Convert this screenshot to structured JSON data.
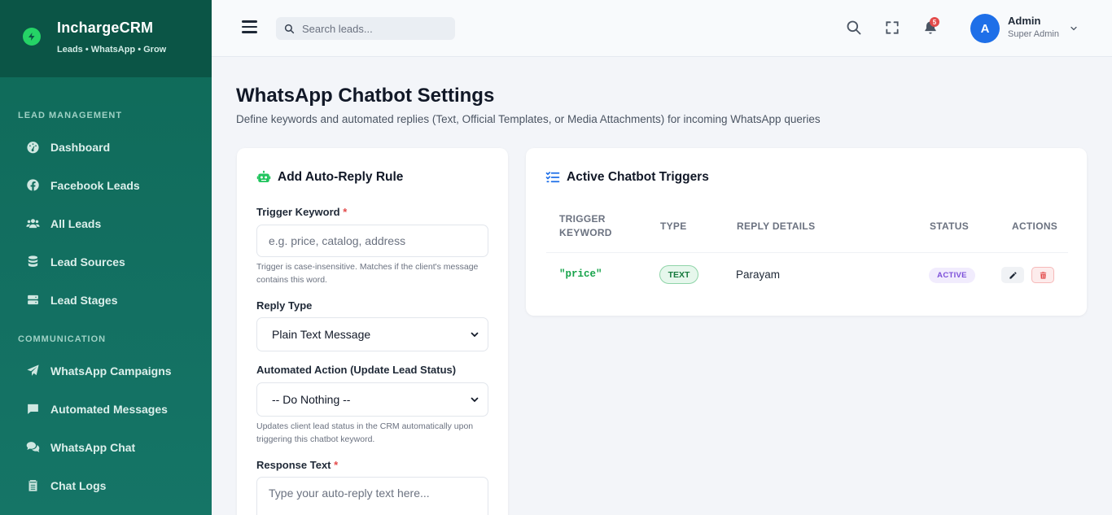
{
  "brand": {
    "name": "InchargeCRM",
    "tagline": "Leads • WhatsApp • Grow"
  },
  "sidebar": {
    "sections": [
      {
        "label": "LEAD MANAGEMENT",
        "items": [
          {
            "label": "Dashboard",
            "icon": "gauge-icon"
          },
          {
            "label": "Facebook Leads",
            "icon": "facebook-icon"
          },
          {
            "label": "All Leads",
            "icon": "users-icon"
          },
          {
            "label": "Lead Sources",
            "icon": "database-icon"
          },
          {
            "label": "Lead Stages",
            "icon": "server-icon"
          }
        ]
      },
      {
        "label": "COMMUNICATION",
        "items": [
          {
            "label": "WhatsApp Campaigns",
            "icon": "paper-plane-icon"
          },
          {
            "label": "Automated Messages",
            "icon": "message-square-icon"
          },
          {
            "label": "WhatsApp Chat",
            "icon": "comments-icon"
          },
          {
            "label": "Chat Logs",
            "icon": "clipboard-list-icon"
          }
        ]
      }
    ]
  },
  "header": {
    "search_placeholder": "Search leads...",
    "notification_count": "5",
    "user": {
      "initial": "A",
      "name": "Admin",
      "role": "Super Admin"
    }
  },
  "page": {
    "title": "WhatsApp Chatbot Settings",
    "subtitle": "Define keywords and automated replies (Text, Official Templates, or Media Attachments) for incoming WhatsApp queries"
  },
  "form": {
    "title": "Add Auto-Reply Rule",
    "trigger_label": "Trigger Keyword",
    "required_mark": "*",
    "trigger_placeholder": "e.g. price, catalog, address",
    "trigger_hint": "Trigger is case-insensitive. Matches if the client's message contains this word.",
    "reply_type_label": "Reply Type",
    "reply_type_value": "Plain Text Message",
    "action_label": "Automated Action (Update Lead Status)",
    "action_value": "-- Do Nothing --",
    "action_hint": "Updates client lead status in the CRM automatically upon triggering this chatbot keyword.",
    "response_label": "Response Text",
    "response_placeholder": "Type your auto-reply text here..."
  },
  "triggers": {
    "title": "Active Chatbot Triggers",
    "columns": [
      "TRIGGER KEYWORD",
      "TYPE",
      "REPLY DETAILS",
      "STATUS",
      "ACTIONS"
    ],
    "rows": [
      {
        "keyword": "\"price\"",
        "type": "TEXT",
        "reply": "Parayam",
        "status": "ACTIVE"
      }
    ]
  },
  "colors": {
    "sidebar": "#0f6a58",
    "accent_blue": "#1e6fe8",
    "whatsapp_green": "#25d366",
    "danger": "#e34b4b",
    "status_purple": "#7c4fd9"
  }
}
